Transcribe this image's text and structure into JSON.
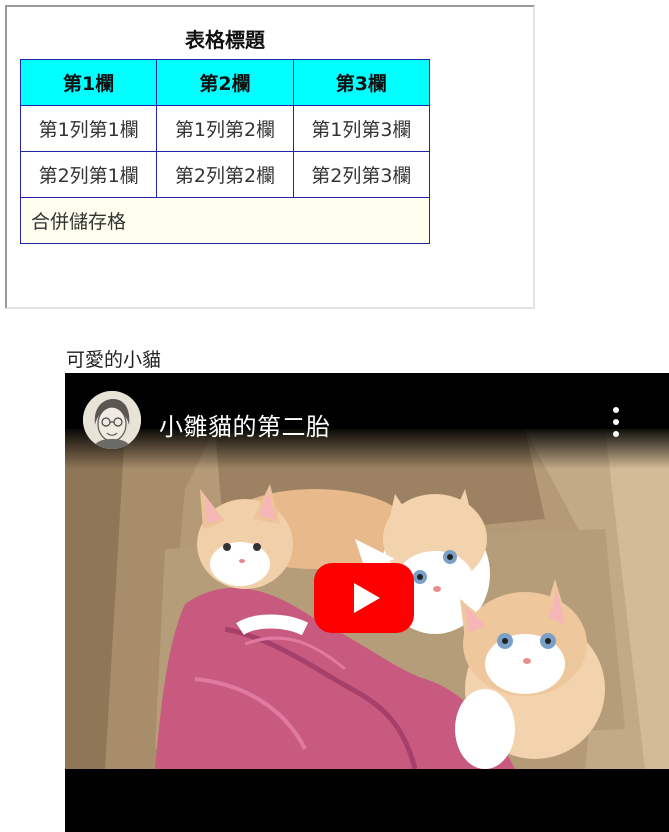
{
  "table": {
    "caption": "表格標題",
    "headers": [
      "第1欄",
      "第2欄",
      "第3欄"
    ],
    "rows": [
      [
        "第1列第1欄",
        "第1列第2欄",
        "第1列第3欄"
      ],
      [
        "第2列第1欄",
        "第2列第2欄",
        "第2列第3欄"
      ]
    ],
    "merged_cell": "合併儲存格"
  },
  "video": {
    "caption": "可愛的小貓",
    "title": "小雛貓的第二胎"
  },
  "colors": {
    "header_bg": "#00ffff",
    "merged_bg": "#fffff0",
    "border": "#2222aa",
    "play_button": "#ff0000"
  },
  "icons": [
    "channel-avatar",
    "more-options-icon",
    "play-icon"
  ]
}
